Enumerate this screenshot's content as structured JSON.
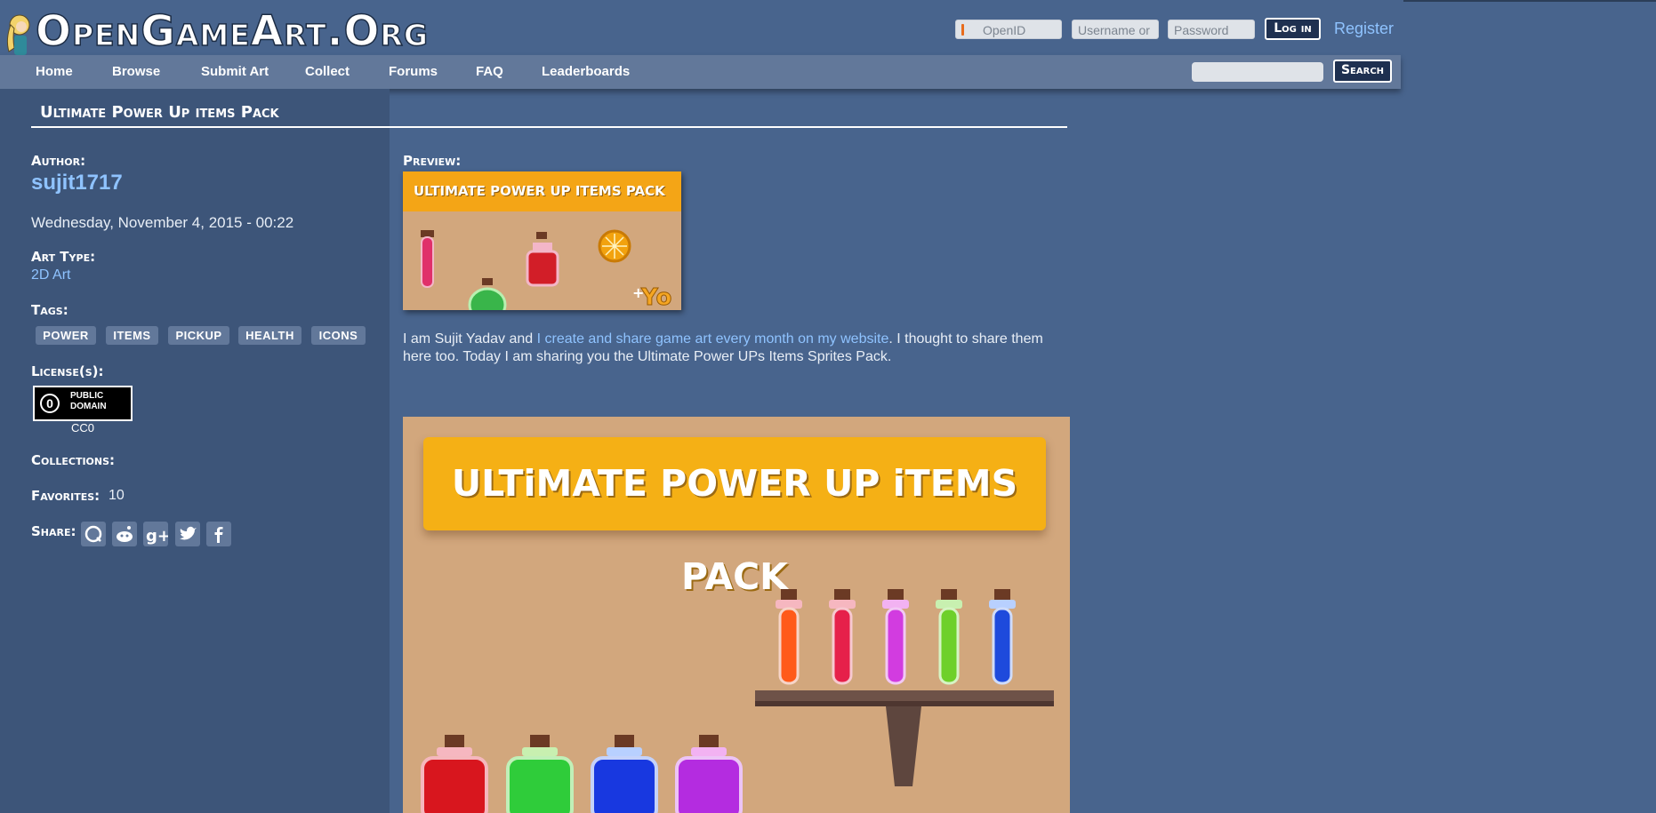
{
  "site": {
    "logo_text": "OpenGameArt.Org"
  },
  "login": {
    "openid_placeholder": "OpenID",
    "username_placeholder": "Username or",
    "password_placeholder": "Password",
    "login_label": "Log in",
    "register_label": "Register"
  },
  "nav": {
    "items": [
      "Home",
      "Browse",
      "Submit Art",
      "Collect",
      "Forums",
      "FAQ",
      "Leaderboards"
    ],
    "search_label": "Search"
  },
  "page": {
    "title": "Ultimate Power Up items Pack"
  },
  "sidebar": {
    "author_label": "Author:",
    "author_name": "sujit1717",
    "date": "Wednesday, November 4, 2015 - 00:22",
    "art_type_label": "Art Type:",
    "art_type_value": "2D Art",
    "tags_label": "Tags:",
    "tags": [
      "POWER",
      "ITEMS",
      "PICKUP",
      "HEALTH",
      "ICONS"
    ],
    "license_label": "License(s):",
    "license_badge": {
      "zero": "0",
      "line1": "PUBLIC",
      "line2": "DOMAIN"
    },
    "license_caption": "CC0",
    "collections_label": "Collections:",
    "favorites_label": "Favorites:",
    "favorites_count": "10",
    "share_label": "Share:",
    "share_icons": [
      "q-icon",
      "reddit-icon",
      "google-plus-icon",
      "twitter-icon",
      "facebook-icon"
    ]
  },
  "main": {
    "preview_label": "Preview:",
    "thumb_banner": "ULTIMATE POWER UP ITEMS PACK",
    "description_before": "I am Sujit Yadav and ",
    "description_link": "I create and share game art every month on my website",
    "description_after": ". I thought to share them here too. Today I am sharing you the Ultimate Power UPs Items Sprites Pack.",
    "big_banner": "ULTiMATE POWER UP iTEMS PACK"
  },
  "colors": {
    "background": "#48648d",
    "sidebar": "#3d5579",
    "nav": "#62789a",
    "link": "#8fc3ff",
    "banner": "#f5b015",
    "image_bg": "#d2a77d"
  }
}
